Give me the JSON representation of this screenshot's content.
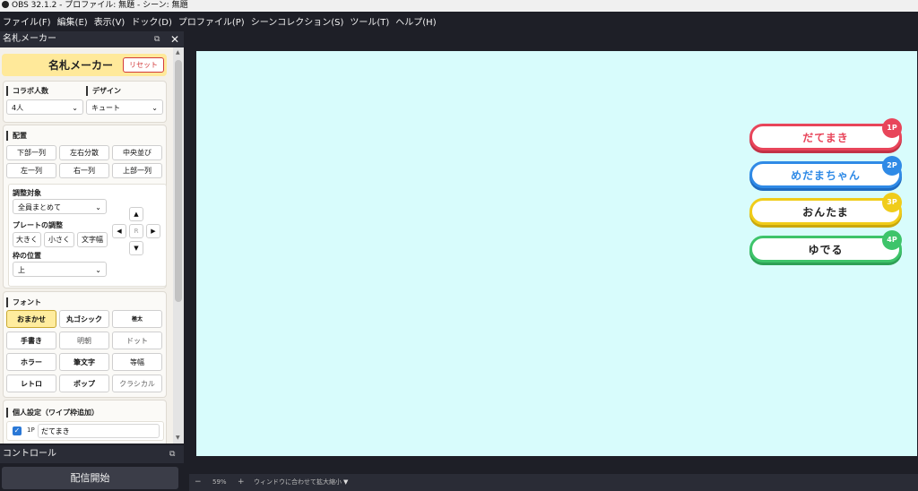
{
  "window": {
    "title": "OBS 32.1.2 - プロファイル: 無題 - シーン: 無題"
  },
  "menu": [
    "ファイル(F)",
    "編集(E)",
    "表示(V)",
    "ドック(D)",
    "プロファイル(P)",
    "シーンコレクション(S)",
    "ツール(T)",
    "ヘルプ(H)"
  ],
  "dock": {
    "title": "名札メーカー",
    "undock_icon": "⧉",
    "close_icon": "✕",
    "header_title": "名札メーカー",
    "reset_label": "リセット",
    "collab_label": "コラボ人数",
    "collab_value": "4人",
    "design_label": "デザイン",
    "design_value": "キュート",
    "layout_label": "配置",
    "layout_buttons": [
      "下部一列",
      "左右分散",
      "中央並び",
      "左一列",
      "右一列",
      "上部一列"
    ],
    "target_label": "調整対象",
    "target_value": "全員まとめて",
    "plate_adjust_label": "プレートの調整",
    "plate_buttons": [
      "大きく",
      "小さく",
      "文字幅"
    ],
    "frame_pos_label": "枠の位置",
    "frame_pos_value": "上",
    "arrows": {
      "up": "▲",
      "left": "◀",
      "center": "R",
      "right": "▶",
      "down": "▼"
    },
    "font_label": "フォント",
    "font_buttons": [
      "おまかせ",
      "丸ゴシック",
      "極太",
      "手書き",
      "明朝",
      "ドット",
      "ホラー",
      "筆文字",
      "等幅",
      "レトロ",
      "ポップ",
      "クラシカル"
    ],
    "font_selected": "おまかせ",
    "personal_label": "個人設定（ワイプ枠追加）",
    "personal_row": {
      "checked": true,
      "player": "1P",
      "name": "だてまき"
    }
  },
  "controls": {
    "title": "コントロール",
    "undock_icon": "⧉",
    "start_label": "配信開始"
  },
  "canvas": {
    "background": "#d8fcfc"
  },
  "nameplates": [
    {
      "badge": "1P",
      "name": "だてまき",
      "color": "#e8455a"
    },
    {
      "badge": "2P",
      "name": "めだまちゃん",
      "color": "#2f8ae6"
    },
    {
      "badge": "3P",
      "name": "おんたま",
      "color": "#f0cc1a"
    },
    {
      "badge": "4P",
      "name": "ゆでる",
      "color": "#3ec46a"
    }
  ],
  "statusbar": {
    "minus": "−",
    "zoom": "59%",
    "plus": "+",
    "fit_label": "ウィンドウに合わせて拡大縮小",
    "dropdown_icon": "▼"
  }
}
